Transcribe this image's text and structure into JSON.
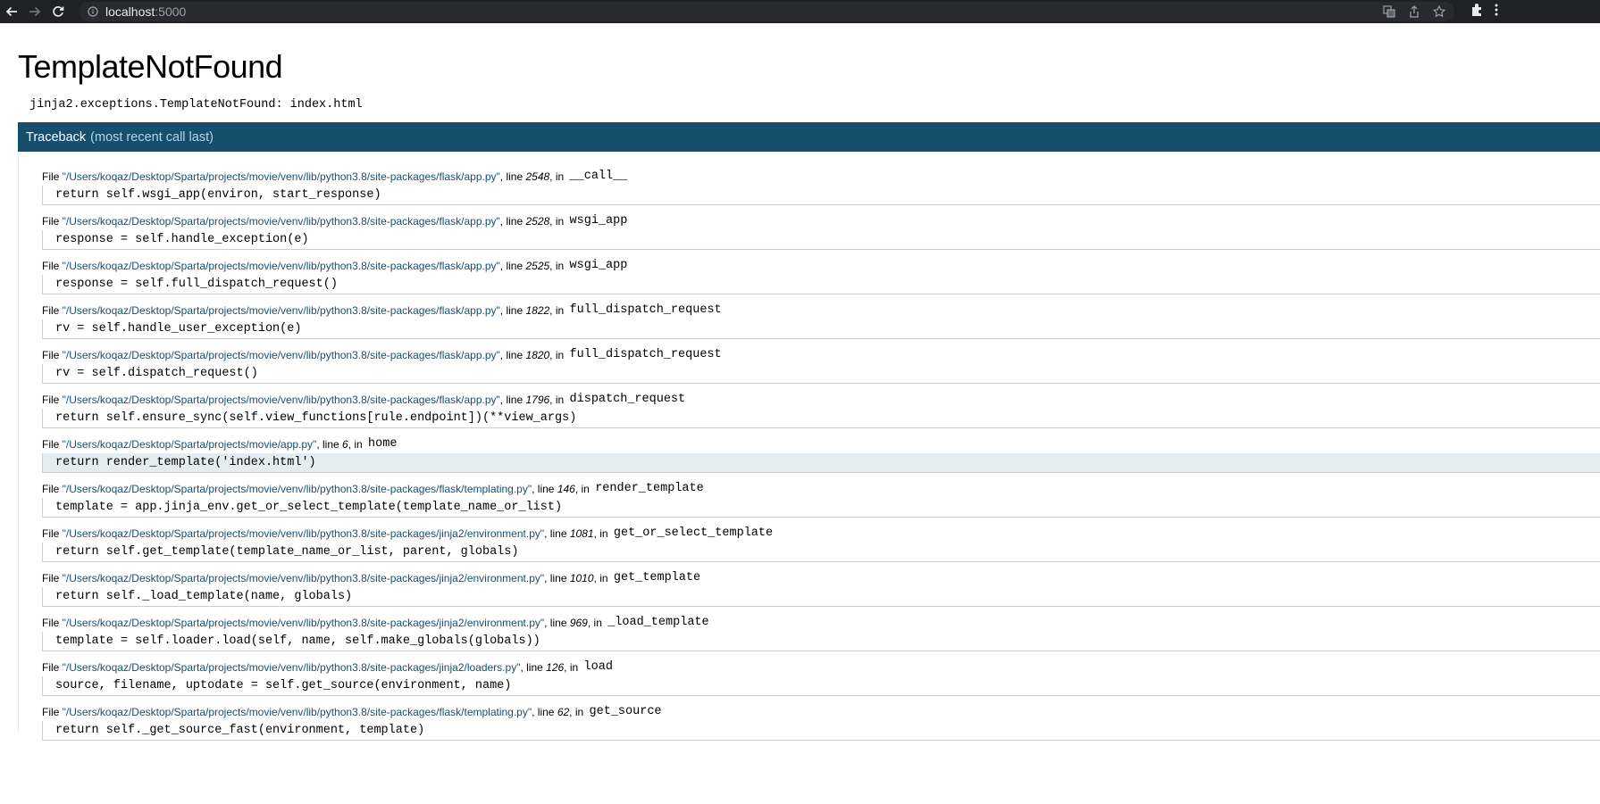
{
  "browser": {
    "url_host": "localhost",
    "url_port": ":5000"
  },
  "page": {
    "title": "TemplateNotFound",
    "error_message": "jinja2.exceptions.TemplateNotFound: index.html",
    "traceback_title": "Traceback",
    "traceback_subtitle": "(most recent call last)"
  },
  "frames": [
    {
      "prefix": "File ",
      "path": "\"/Users/koqaz/Desktop/Sparta/projects/movie/venv/lib/python3.8/site-packages/flask/app.py\"",
      "mid": ", line ",
      "lineno": "2548",
      "in": ", in ",
      "func": "__call__",
      "code": "return self.wsgi_app(environ, start_response)",
      "highlight": false
    },
    {
      "prefix": "File ",
      "path": "\"/Users/koqaz/Desktop/Sparta/projects/movie/venv/lib/python3.8/site-packages/flask/app.py\"",
      "mid": ", line ",
      "lineno": "2528",
      "in": ", in ",
      "func": "wsgi_app",
      "code": "response = self.handle_exception(e)",
      "highlight": false
    },
    {
      "prefix": "File ",
      "path": "\"/Users/koqaz/Desktop/Sparta/projects/movie/venv/lib/python3.8/site-packages/flask/app.py\"",
      "mid": ", line ",
      "lineno": "2525",
      "in": ", in ",
      "func": "wsgi_app",
      "code": "response = self.full_dispatch_request()",
      "highlight": false
    },
    {
      "prefix": "File ",
      "path": "\"/Users/koqaz/Desktop/Sparta/projects/movie/venv/lib/python3.8/site-packages/flask/app.py\"",
      "mid": ", line ",
      "lineno": "1822",
      "in": ", in ",
      "func": "full_dispatch_request",
      "code": "rv = self.handle_user_exception(e)",
      "highlight": false
    },
    {
      "prefix": "File ",
      "path": "\"/Users/koqaz/Desktop/Sparta/projects/movie/venv/lib/python3.8/site-packages/flask/app.py\"",
      "mid": ", line ",
      "lineno": "1820",
      "in": ", in ",
      "func": "full_dispatch_request",
      "code": "rv = self.dispatch_request()",
      "highlight": false
    },
    {
      "prefix": "File ",
      "path": "\"/Users/koqaz/Desktop/Sparta/projects/movie/venv/lib/python3.8/site-packages/flask/app.py\"",
      "mid": ", line ",
      "lineno": "1796",
      "in": ", in ",
      "func": "dispatch_request",
      "code": "return self.ensure_sync(self.view_functions[rule.endpoint])(**view_args)",
      "highlight": false
    },
    {
      "prefix": "File ",
      "path": "\"/Users/koqaz/Desktop/Sparta/projects/movie/app.py\"",
      "mid": ", line ",
      "lineno": "6",
      "in": ", in ",
      "func": "home",
      "code": "return render_template('index.html')",
      "highlight": true
    },
    {
      "prefix": "File ",
      "path": "\"/Users/koqaz/Desktop/Sparta/projects/movie/venv/lib/python3.8/site-packages/flask/templating.py\"",
      "mid": ", line ",
      "lineno": "146",
      "in": ", in ",
      "func": "render_template",
      "code": "template = app.jinja_env.get_or_select_template(template_name_or_list)",
      "highlight": false
    },
    {
      "prefix": "File ",
      "path": "\"/Users/koqaz/Desktop/Sparta/projects/movie/venv/lib/python3.8/site-packages/jinja2/environment.py\"",
      "mid": ", line ",
      "lineno": "1081",
      "in": ", in ",
      "func": "get_or_select_template",
      "code": "return self.get_template(template_name_or_list, parent, globals)",
      "highlight": false
    },
    {
      "prefix": "File ",
      "path": "\"/Users/koqaz/Desktop/Sparta/projects/movie/venv/lib/python3.8/site-packages/jinja2/environment.py\"",
      "mid": ", line ",
      "lineno": "1010",
      "in": ", in ",
      "func": "get_template",
      "code": "return self._load_template(name, globals)",
      "highlight": false
    },
    {
      "prefix": "File ",
      "path": "\"/Users/koqaz/Desktop/Sparta/projects/movie/venv/lib/python3.8/site-packages/jinja2/environment.py\"",
      "mid": ", line ",
      "lineno": "969",
      "in": ", in ",
      "func": "_load_template",
      "code": "template = self.loader.load(self, name, self.make_globals(globals))",
      "highlight": false
    },
    {
      "prefix": "File ",
      "path": "\"/Users/koqaz/Desktop/Sparta/projects/movie/venv/lib/python3.8/site-packages/jinja2/loaders.py\"",
      "mid": ", line ",
      "lineno": "126",
      "in": ", in ",
      "func": "load",
      "code": "source, filename, uptodate = self.get_source(environment, name)",
      "highlight": false
    },
    {
      "prefix": "File ",
      "path": "\"/Users/koqaz/Desktop/Sparta/projects/movie/venv/lib/python3.8/site-packages/flask/templating.py\"",
      "mid": ", line ",
      "lineno": "62",
      "in": ", in ",
      "func": "get_source",
      "code": "return self._get_source_fast(environment, template)",
      "highlight": false
    }
  ]
}
